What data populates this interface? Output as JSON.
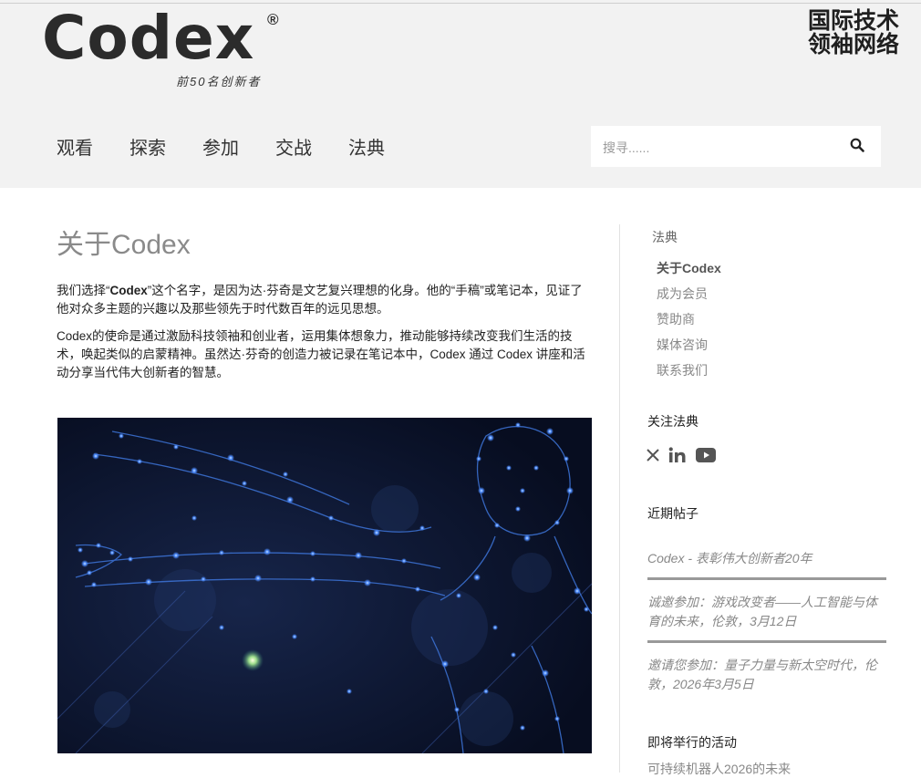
{
  "header": {
    "logo_text": "Codex",
    "logo_mark": "®",
    "tagline": "前50名创新者",
    "network_line1": "国际技术",
    "network_line2": "领袖网络"
  },
  "nav": {
    "items": [
      {
        "label": "观看"
      },
      {
        "label": "探索"
      },
      {
        "label": "参加"
      },
      {
        "label": "交战"
      },
      {
        "label": "法典"
      }
    ]
  },
  "search": {
    "placeholder": "搜寻......",
    "icon": "search-icon"
  },
  "main": {
    "title": "关于Codex",
    "paragraphs": [
      {
        "prefix": "我们选择“",
        "bold": "Codex",
        "suffix": "”这个名字，是因为达·芬奇是文艺复兴理想的化身。他的“手稿”或笔记本，见证了他对众多主题的兴趣以及那些领先于时代数百年的远见思想。"
      },
      {
        "text": "Codex的使命是通过激励科技领袖和创业者，运用集体想象力，推动能够持续改变我们生活的技术，唤起类似的启蒙精神。虽然达·芬奇的创造力被记录在笔记本中，Codex 通过 Codex 讲座和活动分享当代伟大创新者的智慧。"
      }
    ]
  },
  "sidebar": {
    "section_title": "法典",
    "links": [
      {
        "label": "关于Codex",
        "active": true
      },
      {
        "label": "成为会员"
      },
      {
        "label": "赞助商"
      },
      {
        "label": "媒体咨询"
      },
      {
        "label": "联系我们"
      }
    ],
    "follow_title": "关注法典",
    "social": [
      "x-icon",
      "linkedin-icon",
      "youtube-icon"
    ],
    "recent_title": "近期帖子",
    "posts": [
      {
        "title": "Codex - 表彰伟大创新者20年"
      },
      {
        "title": "诚邀参加：游戏改变者——人工智能与体育的未来，伦敦，3月12日"
      },
      {
        "title": "邀请您参加：量子力量与新太空时代，伦敦，2026年3月5日"
      }
    ],
    "events_title": "即将举行的活动",
    "events": [
      {
        "title": "可持续机器人2026的未来"
      }
    ]
  },
  "colors": {
    "header_bg": "#f2f2f2",
    "accent_glow": "#4d8cff",
    "hero_bg": "#0a1228"
  }
}
